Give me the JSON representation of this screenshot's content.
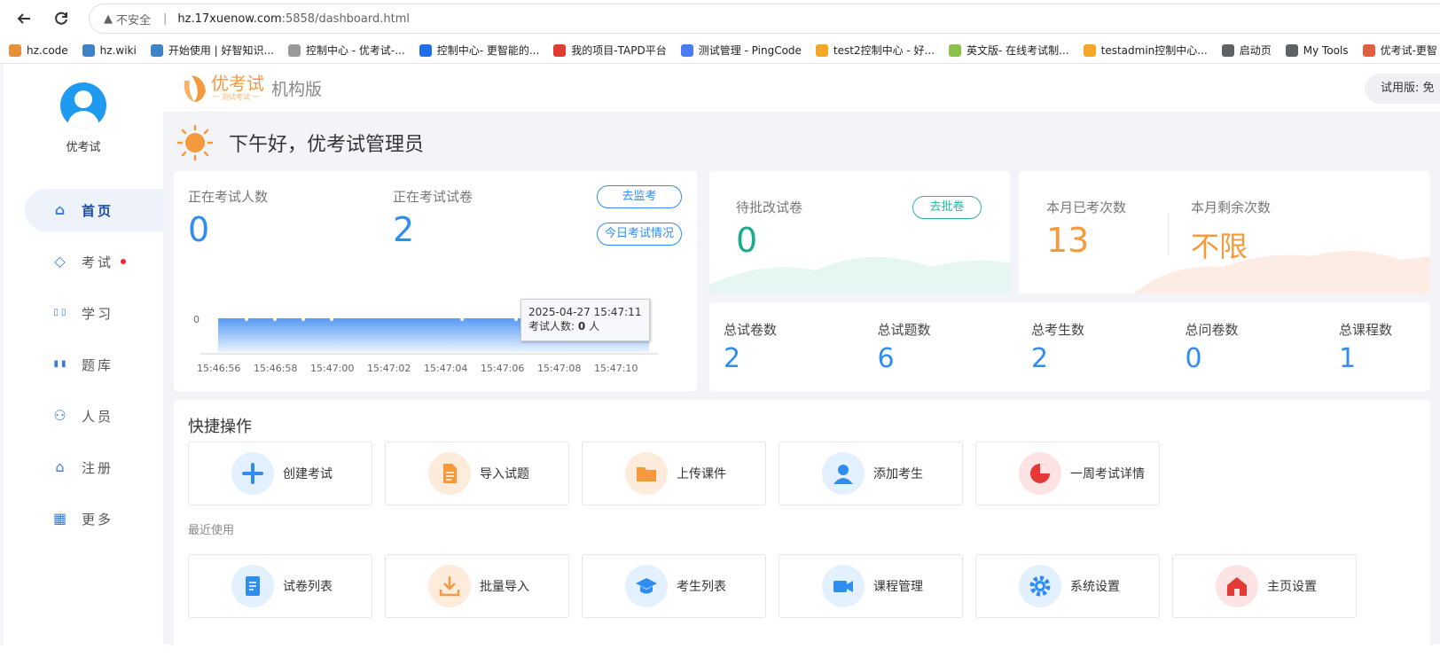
{
  "browser": {
    "warning": "不安全",
    "url_host": "hz.17xuenow.com",
    "url_rest": ":5858/dashboard.html",
    "bookmarks": [
      {
        "label": "hz.code",
        "color": "#e69138"
      },
      {
        "label": "hz.wiki",
        "color": "#3d85c6"
      },
      {
        "label": "开始使用 | 好智知识...",
        "color": "#3d85c6"
      },
      {
        "label": "控制中心 - 优考试-...",
        "color": "#999999"
      },
      {
        "label": "控制中心- 更智能的...",
        "color": "#1f6feb"
      },
      {
        "label": "我的项目-TAPD平台",
        "color": "#e03c31"
      },
      {
        "label": "测试管理 - PingCode",
        "color": "#4a7cf6"
      },
      {
        "label": "test2控制中心 - 好...",
        "color": "#f5a623"
      },
      {
        "label": "英文版- 在线考试制...",
        "color": "#8bc34a"
      },
      {
        "label": "testadmin控制中心...",
        "color": "#f5a623"
      },
      {
        "label": "启动页",
        "color": "#5f6368"
      },
      {
        "label": "My Tools",
        "color": "#5f6368"
      },
      {
        "label": "优考试-更智",
        "color": "#e06040"
      }
    ]
  },
  "sidebar": {
    "username": "优考试",
    "items": [
      {
        "label": "首页",
        "icon": "home-icon",
        "active": true
      },
      {
        "label": "考试",
        "icon": "tag-icon",
        "badge": true
      },
      {
        "label": "学习",
        "icon": "book-icon"
      },
      {
        "label": "题库",
        "icon": "bar-chart-icon"
      },
      {
        "label": "人员",
        "icon": "user-icon"
      },
      {
        "label": "注册",
        "icon": "home-icon"
      },
      {
        "label": "更多",
        "icon": "grid-icon"
      }
    ]
  },
  "header": {
    "logo_text": "优考试",
    "logo_sub": "一 测试考试 一",
    "edition": "机构版",
    "trial": "试用版: 免"
  },
  "greeting": "下午好，优考试管理员",
  "live": {
    "examinees_label": "正在考试人数",
    "examinees_value": "0",
    "papers_label": "正在考试试卷",
    "papers_value": "2",
    "monitor_button": "去监考",
    "today_button": "今日考试情况",
    "tooltip_time": "2025-04-27 15:47:11",
    "tooltip_label": "考试人数:",
    "tooltip_value": "0",
    "tooltip_unit": "人"
  },
  "chart_data": {
    "type": "area",
    "x": [
      "15:46:56",
      "15:46:58",
      "15:47:00",
      "15:47:02",
      "15:47:04",
      "15:47:06",
      "15:47:08",
      "15:47:10"
    ],
    "y_ticks": [
      "0"
    ],
    "series": [
      {
        "values": [
          0,
          0,
          0,
          0,
          0,
          0,
          0,
          0
        ]
      }
    ],
    "color": "#5b9df5"
  },
  "grading": {
    "label": "待批改试卷",
    "value": "0",
    "button": "去批卷"
  },
  "monthly": {
    "used_label": "本月已考次数",
    "used_value": "13",
    "remain_label": "本月剩余次数",
    "remain_value": "不限"
  },
  "totals": [
    {
      "label": "总试卷数",
      "value": "2"
    },
    {
      "label": "总试题数",
      "value": "6"
    },
    {
      "label": "总考生数",
      "value": "2"
    },
    {
      "label": "总问卷数",
      "value": "0"
    },
    {
      "label": "总课程数",
      "value": "1"
    }
  ],
  "quick": {
    "title": "快捷操作",
    "actions": [
      {
        "label": "创建考试",
        "icon": "plus-icon",
        "bg": "#e3f0fd",
        "fg": "#2f8df2"
      },
      {
        "label": "导入试题",
        "icon": "document-icon",
        "bg": "#fdebdc",
        "fg": "#f59a3c"
      },
      {
        "label": "上传课件",
        "icon": "folder-icon",
        "bg": "#fdebdc",
        "fg": "#f59a3c"
      },
      {
        "label": "添加考生",
        "icon": "person-icon",
        "bg": "#e3f0fd",
        "fg": "#2f8df2"
      },
      {
        "label": "一周考试详情",
        "icon": "pie-icon",
        "bg": "#fde3e3",
        "fg": "#e53935"
      }
    ],
    "recent_title": "最近使用",
    "recent": [
      {
        "label": "试卷列表",
        "icon": "list-icon",
        "bg": "#e3f0fd",
        "fg": "#2f8df2"
      },
      {
        "label": "批量导入",
        "icon": "download-icon",
        "bg": "#fdebdc",
        "fg": "#f59a3c"
      },
      {
        "label": "考生列表",
        "icon": "graduation-cap-icon",
        "bg": "#e3f0fd",
        "fg": "#2f8df2"
      },
      {
        "label": "课程管理",
        "icon": "video-icon",
        "bg": "#e3f0fd",
        "fg": "#2f8df2"
      },
      {
        "label": "系统设置",
        "icon": "gear-icon",
        "bg": "#e3f0fd",
        "fg": "#2f8df2"
      },
      {
        "label": "主页设置",
        "icon": "house-icon",
        "bg": "#fde3e3",
        "fg": "#e53935"
      }
    ]
  }
}
